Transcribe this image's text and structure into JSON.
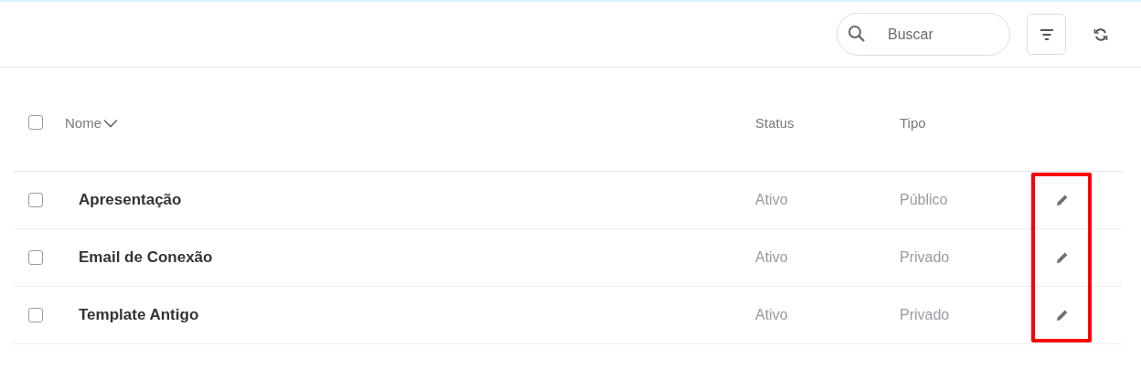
{
  "toolbar": {
    "search": {
      "placeholder": "Buscar"
    }
  },
  "table": {
    "select_all": {
      "checked": false
    },
    "columns": [
      {
        "label": "Nome",
        "sorted": true
      },
      {
        "label": "Status",
        "sorted": false
      },
      {
        "label": "Tipo",
        "sorted": false
      }
    ],
    "rows": [
      {
        "checked": false,
        "name": "Apresentação",
        "status": "Ativo",
        "type": "Público"
      },
      {
        "checked": false,
        "name": "Email de Conexão",
        "status": "Ativo",
        "type": "Privado"
      },
      {
        "checked": false,
        "name": "Template Antigo",
        "status": "Ativo",
        "type": "Privado"
      }
    ]
  }
}
